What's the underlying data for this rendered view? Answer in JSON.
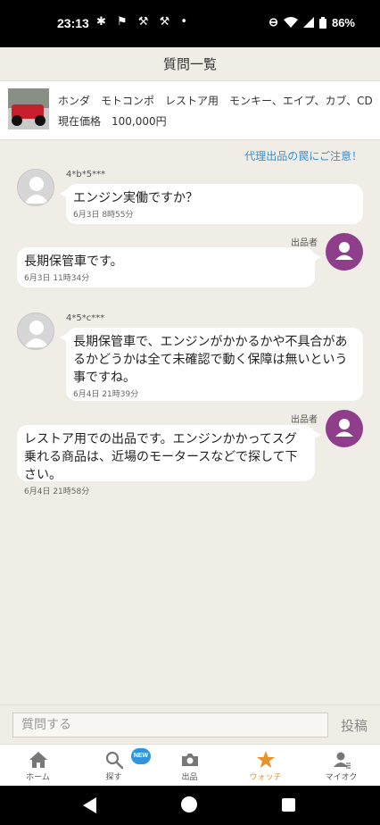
{
  "status_bar": {
    "time": "23:13",
    "notification_icons": "✱ ⚑ ⚒ ⚒ •",
    "battery": "86%"
  },
  "header": {
    "title": "質問一覧"
  },
  "item": {
    "title": "ホンダ　モトコンポ　レストア用　モンキー、エイプ、カブ、CD",
    "price": "現在価格　100,000円"
  },
  "warning_link": "代理出品の罠にご注意！",
  "threads": [
    {
      "asker_id": "4*b*5***",
      "question": "エンジン実働ですか？",
      "question_time": "6月3日 8時55分",
      "seller_label": "出品者",
      "answer": "長期保管車です。",
      "answer_time": "6月3日 11時34分"
    },
    {
      "asker_id": "4*5*c***",
      "question": "長期保管車で、エンジンがかかるかや不具合があるかどうかは全て未確認で動く保障は無いという事ですね。",
      "question_time": "6月4日 21時39分",
      "seller_label": "出品者",
      "answer": "レストア用での出品です。エンジンかかってスグ乗れる商品は、近場のモータースなどで探して下さい。",
      "answer_time": "6月4日 21時58分"
    }
  ],
  "input": {
    "placeholder": "質問する",
    "post_label": "投稿"
  },
  "bottom_nav": {
    "items": [
      {
        "label": "ホーム",
        "icon": "home-icon"
      },
      {
        "label": "探す",
        "icon": "search-icon",
        "badge": "NEW"
      },
      {
        "label": "出品",
        "icon": "camera-icon"
      },
      {
        "label": "ウォッチ",
        "icon": "star-icon",
        "active": true
      },
      {
        "label": "マイオク",
        "icon": "user-icon"
      }
    ]
  },
  "colors": {
    "accent": "#e8922a",
    "link": "#3a8fd0",
    "seller_avatar": "#8e3e8a",
    "background": "#efede6"
  }
}
